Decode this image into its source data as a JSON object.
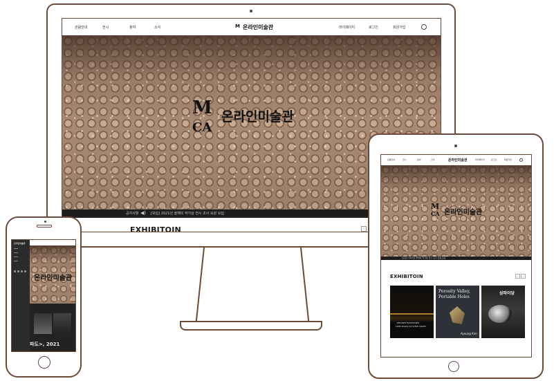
{
  "brand": {
    "name": "온라인미술관",
    "mark": "MMCA"
  },
  "nav": {
    "left": [
      "관람안내",
      "전시",
      "참여",
      "소식"
    ],
    "right": [
      "마이페이지",
      "로그인",
      "회원가입"
    ],
    "search_icon": "search-icon"
  },
  "ticker": {
    "label": "공지사항",
    "text": "[모집] 2021년 올해의 작가상 전시 조사 요원 모집",
    "icon": "speaker-icon"
  },
  "exhibition": {
    "heading": "EXHIBITOIN",
    "posters": [
      {
        "lines": [
          "PROSPE FANTASIES",
          "NEW WAYS TO VIEW LIGHT"
        ]
      },
      {
        "lines": [
          "Porosity Valley,",
          "Portable Holes",
          "Ayoung Kim"
        ]
      },
      {
        "lines": [
          "상파이당"
        ]
      }
    ]
  },
  "phone": {
    "caption": "파도>, 2021"
  },
  "colors": {
    "device_outline": "#6b4a38",
    "dark_bar": "#1d1d1d"
  }
}
